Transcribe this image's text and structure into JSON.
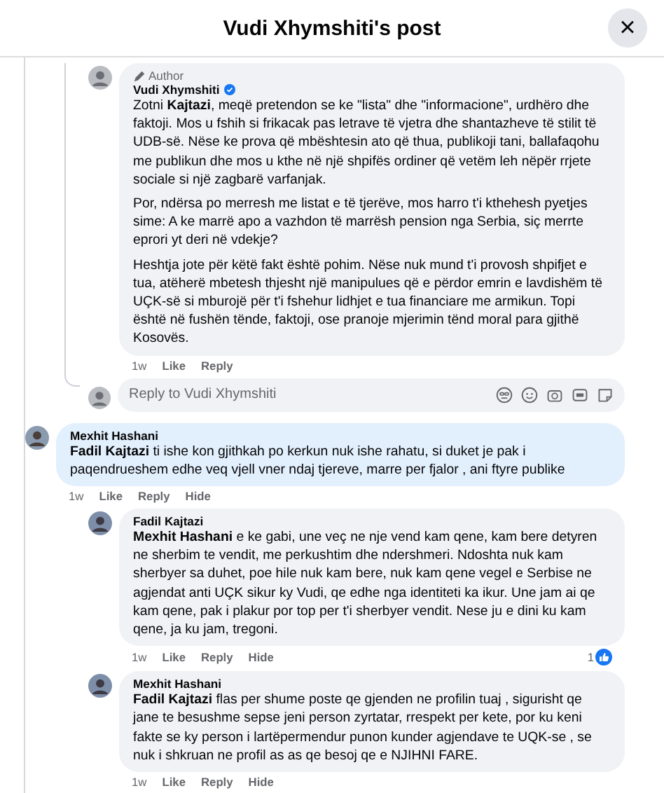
{
  "header": {
    "title": "Vudi Xhymshiti's post",
    "close": "×"
  },
  "thread": {
    "replies": [
      {
        "author": "Vudi Xhymshiti",
        "badge": "Author",
        "verified": true,
        "highlighted": false,
        "paragraphs": [
          "Zotni **Kajtazi**, meqë pretendon se ke \"lista\" dhe \"informacione\", urdhëro dhe faktoji. Mos u fshih si frikacak pas letrave të vjetra dhe shantazheve të stilit të UDB-së. Nëse ke prova që mbështesin ato që thua, publikoji tani, ballafaqohu me publikun dhe mos u kthe në një shpifës ordiner që vetëm leh nëpër rrjete sociale si një zagbarë varfanjak.",
          "Por, ndërsa po merresh me listat e të tjerëve, mos harro t'i kthehesh pyetjes sime: A ke marrë apo a vazhdon të marrësh pension nga Serbia, siç merrte eprori yt deri në vdekje?",
          "Heshtja jote për këtë fakt është pohim. Nëse nuk mund t'i provosh shpifjet e tua, atëherë mbetesh thjesht një manipulues që e përdor emrin e lavdishëm të UÇK-së si mburojë për t'i fshehur lidhjet e tua financiare me armikun. Topi është në fushën tënde, faktoji, ose pranoje mjerimin tënd moral para gjithë Kosovës."
        ],
        "time": "1w",
        "actions": [
          "Like",
          "Reply"
        ]
      }
    ],
    "reply_field": {
      "placeholder": "Reply to Vudi Xhymshiti"
    }
  },
  "comments": [
    {
      "author": "Mexhit Hashani",
      "highlighted": true,
      "paragraphs": [
        "**Fadil Kajtazi** ti ishe kon gjithkah po kerkun nuk ishe rahatu, si duket je pak i paqendrueshem edhe veq vjell vner ndaj tjereve, marre per fjalor , ani ftyre publike"
      ],
      "time": "1w",
      "actions": [
        "Like",
        "Reply",
        "Hide"
      ],
      "children": [
        {
          "author": "Fadil Kajtazi",
          "highlighted": false,
          "paragraphs": [
            "**Mexhit Hashani** e ke gabi, une veç ne nje vend kam qene, kam bere detyren ne sherbim te vendit, me perkushtim dhe ndershmeri. Ndoshta nuk kam sherbyer sa duhet, poe hile nuk kam bere, nuk kam qene vegel e Serbise ne agjendat anti UÇK sikur ky Vudi, qe edhe nga identiteti ka ikur. Une jam ai qe kam qene, pak i plakur por top per t'i sherbyer vendit. Nese ju e dini ku kam qene, ja ku jam, tregoni."
          ],
          "time": "1w",
          "actions": [
            "Like",
            "Reply",
            "Hide"
          ],
          "reactions": "1"
        },
        {
          "author": "Mexhit Hashani",
          "highlighted": false,
          "paragraphs": [
            "**Fadil Kajtazi** flas per shume poste qe gjenden ne profilin tuaj , sigurisht qe jane te besushme sepse jeni person zyrtatar, rrespekt per kete, por ku keni fakte se ky person i lartëpermendur punon kunder agjendave te UQK-se , se nuk i shkruan ne profil as as qe besoj qe e NJIHNI FARE."
          ],
          "time": "1w",
          "actions": [
            "Like",
            "Reply",
            "Hide"
          ]
        }
      ]
    }
  ]
}
